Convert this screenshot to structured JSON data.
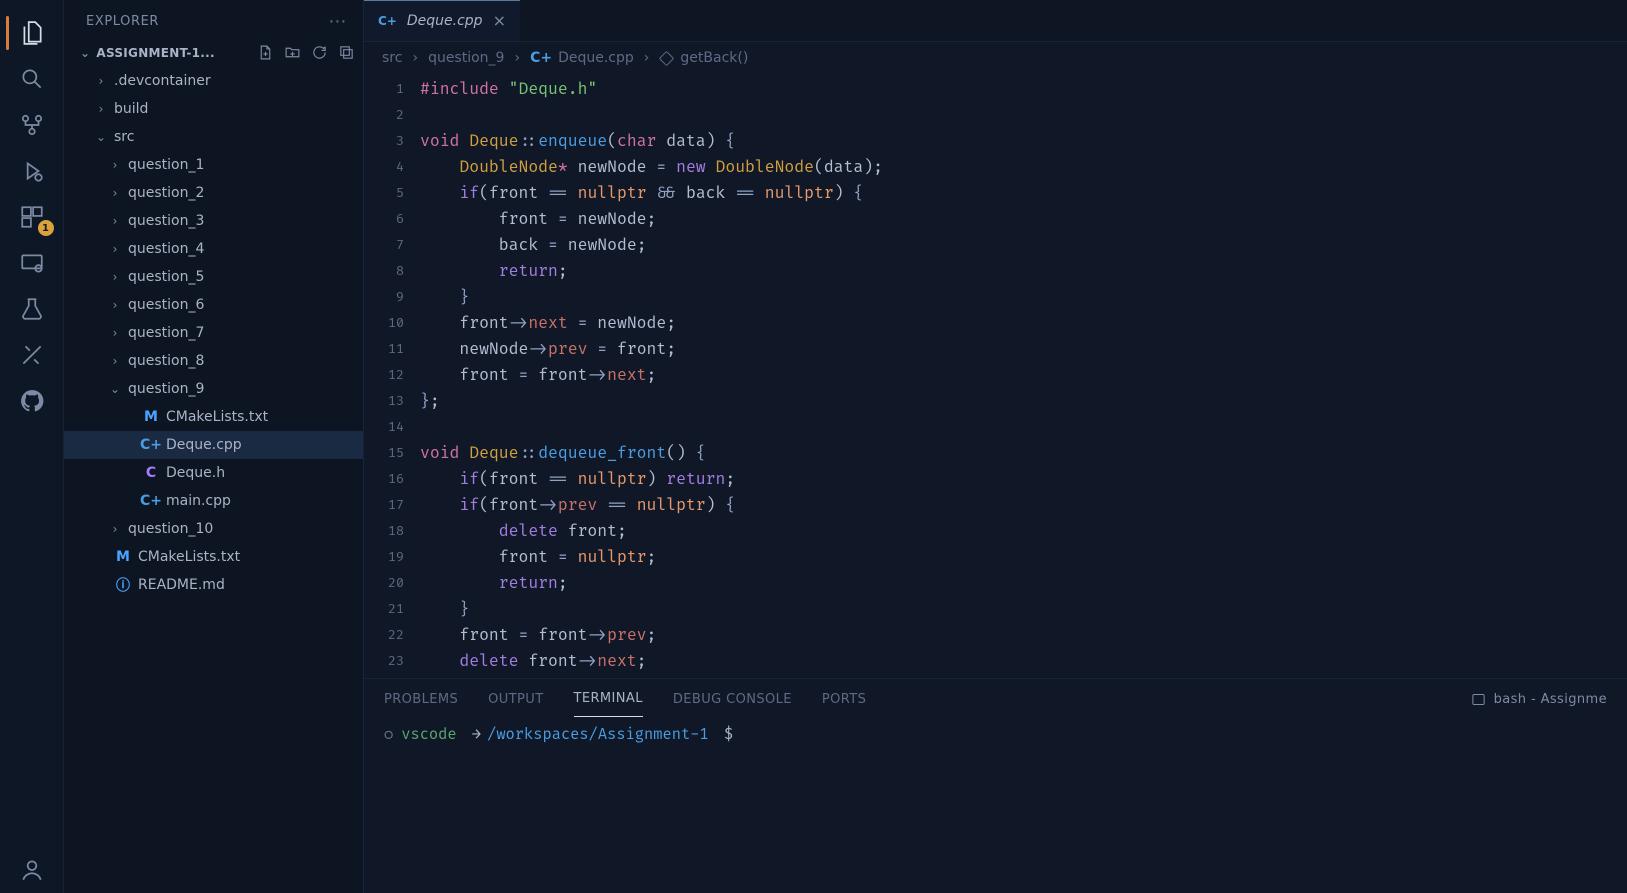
{
  "activity_icons": [
    "files",
    "search",
    "git",
    "debug",
    "extensions",
    "remote",
    "testing",
    "live-share",
    "github"
  ],
  "activity_badge": "1",
  "explorer": {
    "title": "EXPLORER",
    "project_name": "ASSIGNMENT-1...",
    "toolbar_icons": [
      "new-file",
      "new-folder",
      "refresh",
      "collapse-all"
    ]
  },
  "tree": [
    {
      "depth": 1,
      "chev": ">",
      "icon": "",
      "name": ".devcontainer"
    },
    {
      "depth": 1,
      "chev": ">",
      "icon": "",
      "name": "build"
    },
    {
      "depth": 1,
      "chev": "v",
      "icon": "",
      "name": "src"
    },
    {
      "depth": 2,
      "chev": ">",
      "icon": "",
      "name": "question_1"
    },
    {
      "depth": 2,
      "chev": ">",
      "icon": "",
      "name": "question_2"
    },
    {
      "depth": 2,
      "chev": ">",
      "icon": "",
      "name": "question_3"
    },
    {
      "depth": 2,
      "chev": ">",
      "icon": "",
      "name": "question_4"
    },
    {
      "depth": 2,
      "chev": ">",
      "icon": "",
      "name": "question_5"
    },
    {
      "depth": 2,
      "chev": ">",
      "icon": "",
      "name": "question_6"
    },
    {
      "depth": 2,
      "chev": ">",
      "icon": "",
      "name": "question_7"
    },
    {
      "depth": 2,
      "chev": ">",
      "icon": "",
      "name": "question_8"
    },
    {
      "depth": 2,
      "chev": "v",
      "icon": "",
      "name": "question_9"
    },
    {
      "depth": 3,
      "chev": "",
      "icon": "M",
      "name": "CMakeLists.txt",
      "ic_class": "ic-m"
    },
    {
      "depth": 3,
      "chev": "",
      "icon": "C+",
      "name": "Deque.cpp",
      "ic_class": "ic-cpp",
      "selected": true
    },
    {
      "depth": 3,
      "chev": "",
      "icon": "C",
      "name": "Deque.h",
      "ic_class": "ic-h"
    },
    {
      "depth": 3,
      "chev": "",
      "icon": "C+",
      "name": "main.cpp",
      "ic_class": "ic-cpp"
    },
    {
      "depth": 2,
      "chev": ">",
      "icon": "",
      "name": "question_10"
    },
    {
      "depth": 1,
      "chev": "",
      "icon": "M",
      "name": "CMakeLists.txt",
      "ic_class": "ic-m"
    },
    {
      "depth": 1,
      "chev": "",
      "icon": "ⓘ",
      "name": "README.md",
      "ic_class": "ic-info"
    }
  ],
  "tab": {
    "icon": "C+",
    "label": "Deque.cpp"
  },
  "breadcrumb": {
    "parts": [
      "src",
      "question_9"
    ],
    "file": "Deque.cpp",
    "symbol": "getBack()"
  },
  "code_lines": [
    "<span class='pp'>#include</span> <span class='ppfile'>\"Deque.h\"</span>",
    "",
    "<span class='kw'>void</span> <span class='type'>Deque</span><span class='op'>::</span><span class='fn'>enqueue</span>(<span class='kw'>char</span> <span class='id'>data</span>) <span class='brace'>{</span>",
    "    <span class='type'>DoubleNode</span><span class='ptr'>*</span> <span class='id'>newNode</span> <span class='op'>=</span> <span class='kw2'>new</span> <span class='type'>DoubleNode</span>(<span class='id'>data</span>);",
    "    <span class='kw2'>if</span>(<span class='id'>front</span> <span class='op'>==</span> <span class='const'>nullptr</span> <span class='op'>&&</span> <span class='id'>back</span> <span class='op'>==</span> <span class='const'>nullptr</span>) <span class='brace'>{</span>",
    "        <span class='id'>front</span> <span class='op'>=</span> <span class='id'>newNode</span>;",
    "        <span class='id'>back</span> <span class='op'>=</span> <span class='id'>newNode</span>;",
    "        <span class='kw2'>return</span>;",
    "    <span class='brace'>}</span>",
    "    <span class='id'>front</span><span class='op'>-></span><span class='mem'>next</span> <span class='op'>=</span> <span class='id'>newNode</span>;",
    "    <span class='id'>newNode</span><span class='op'>-></span><span class='mem'>prev</span> <span class='op'>=</span> <span class='id'>front</span>;",
    "    <span class='id'>front</span> <span class='op'>=</span> <span class='id'>front</span><span class='op'>-></span><span class='mem'>next</span>;",
    "<span class='brace'>}</span>;",
    "",
    "<span class='kw'>void</span> <span class='type'>Deque</span><span class='op'>::</span><span class='fn'>dequeue_front</span>() <span class='brace'>{</span>",
    "    <span class='kw2'>if</span>(<span class='id'>front</span> <span class='op'>==</span> <span class='const'>nullptr</span>) <span class='kw2'>return</span>;",
    "    <span class='kw2'>if</span>(<span class='id'>front</span><span class='op'>-></span><span class='mem'>prev</span> <span class='op'>==</span> <span class='const'>nullptr</span>) <span class='brace'>{</span>",
    "        <span class='kw2'>delete</span> <span class='id'>front</span>;",
    "        <span class='id'>front</span> <span class='op'>=</span> <span class='const'>nullptr</span>;",
    "        <span class='kw2'>return</span>;",
    "    <span class='brace'>}</span>",
    "    <span class='id'>front</span> <span class='op'>=</span> <span class='id'>front</span><span class='op'>-></span><span class='mem'>prev</span>;",
    "    <span class='kw2'>delete</span> <span class='id'>front</span><span class='op'>-></span><span class='mem'>next</span>;"
  ],
  "panel": {
    "tabs": [
      "PROBLEMS",
      "OUTPUT",
      "TERMINAL",
      "DEBUG CONSOLE",
      "PORTS"
    ],
    "active_tab": "TERMINAL",
    "shell_label": "bash - Assignme"
  },
  "terminal": {
    "user": "vscode",
    "path": "/workspaces/Assignment-1",
    "prompt": "$"
  }
}
